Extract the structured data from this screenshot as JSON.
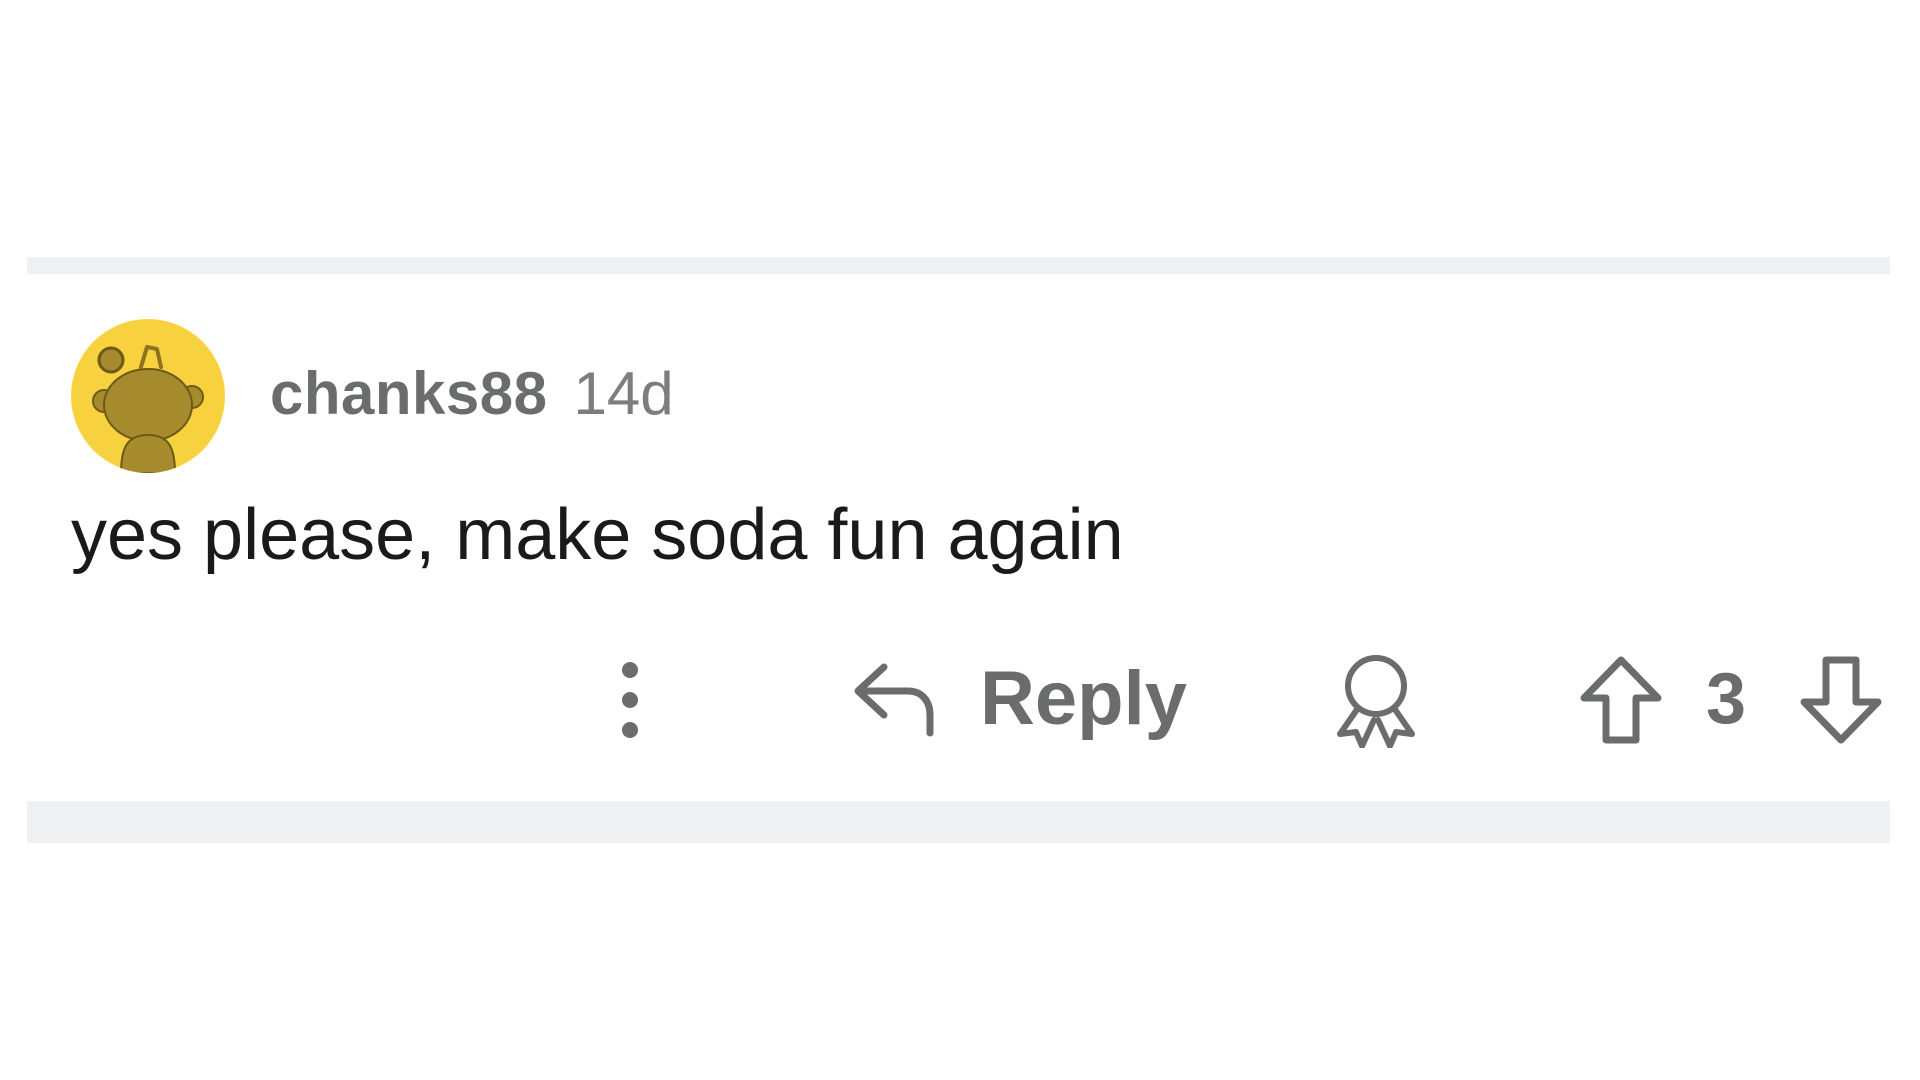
{
  "comment": {
    "username": "chanks88",
    "age": "14d",
    "body": "yes please, make soda fun again",
    "avatar_color": "#f7d23e"
  },
  "actions": {
    "more_icon": "more-vertical-icon",
    "reply_icon": "reply-arrow-icon",
    "reply_label": "Reply",
    "award_icon": "award-icon",
    "upvote_icon": "upvote-arrow-icon",
    "score": "3",
    "downvote_icon": "downvote-arrow-icon"
  }
}
